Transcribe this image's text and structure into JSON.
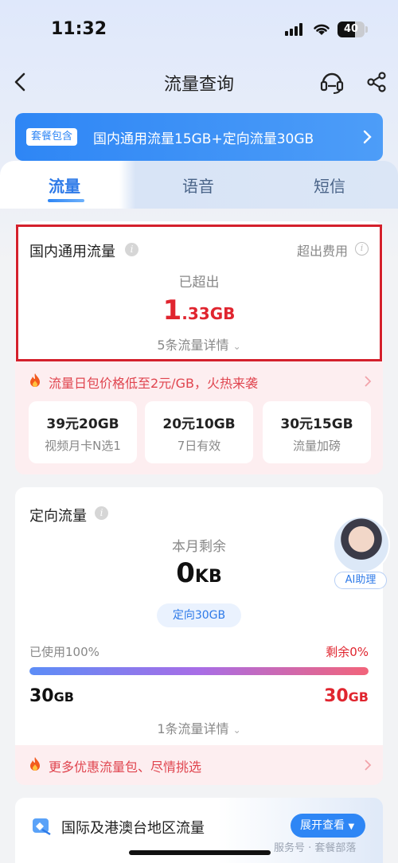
{
  "status_bar": {
    "time": "11:32",
    "battery": "40"
  },
  "nav": {
    "title": "流量查询"
  },
  "plan": {
    "badge": "套餐包含",
    "text": "国内通用流量15GB+定向流量30GB"
  },
  "tabs": [
    {
      "label": "流量",
      "active": true
    },
    {
      "label": "语音",
      "active": false
    },
    {
      "label": "短信",
      "active": false
    }
  ],
  "general": {
    "title": "国内通用流量",
    "over_fee_label": "超出费用",
    "status_label": "已超出",
    "over_value": "1.33",
    "over_value_lead": "1",
    "over_value_rest": ".33",
    "over_unit": "GB",
    "detail_link": "5条流量详情"
  },
  "promo1": {
    "text": "流量日包价格低至2元/GB，火热来袭"
  },
  "packages": [
    {
      "title": "39元20GB",
      "subtitle": "视频月卡N选1"
    },
    {
      "title": "20元10GB",
      "subtitle": "7日有效"
    },
    {
      "title": "30元15GB",
      "subtitle": "流量加磅"
    }
  ],
  "directional": {
    "title": "定向流量",
    "remain_label": "本月剩余",
    "remain_value": "0",
    "remain_unit": "KB",
    "quota_pill": "定向30GB",
    "used_label": "已使用100%",
    "remain_pct_label": "剩余0%",
    "used_fraction": 1.0,
    "used_amount": "30",
    "total_amount": "30",
    "amount_unit": "GB",
    "detail_link": "1条流量详情"
  },
  "ai_assistant": {
    "label": "AI助理"
  },
  "promo2": {
    "text": "更多优惠流量包、尽情挑选"
  },
  "international": {
    "title": "国际及港澳台地区流量",
    "expand_label": "展开查看"
  },
  "watermark": "服务号 · 套餐部落",
  "colors": {
    "accent": "#2e86f5",
    "alert": "#e0252f",
    "highlight_frame": "#d4202c"
  },
  "icons": [
    "back-icon",
    "headset-icon",
    "share-icon",
    "chevron-right-icon",
    "info-icon",
    "fire-icon",
    "chevron-down-icon",
    "globe-icon"
  ]
}
